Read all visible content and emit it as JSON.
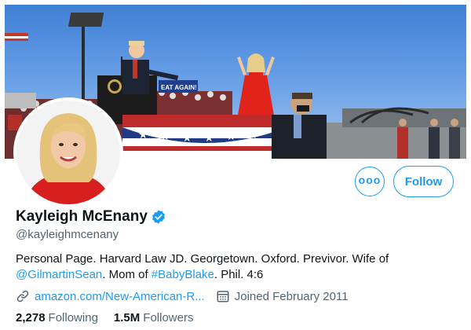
{
  "profile": {
    "name": "Kayleigh McEnany",
    "handle": "@kayleighmcenany",
    "bio": {
      "part1": "Personal Page. Harvard Law JD. Georgetown. Oxford. Previvor. Wife of ",
      "mention": "@GilmartinSean",
      "part2": ". Mom of ",
      "hashtag": "#BabyBlake",
      "part3": ". Phil. 4:6"
    },
    "website": "amazon.com/New-American-R...",
    "joined": "Joined February 2011"
  },
  "stats": {
    "following_count": "2,278",
    "following_label": "Following",
    "followers_count": "1.5M",
    "followers_label": "Followers"
  },
  "actions": {
    "more_label": "ooo",
    "follow_label": "Follow"
  },
  "banner": {
    "sign_text": "EAT AGAIN!"
  },
  "colors": {
    "accent": "#1d9bf0",
    "text": "#0f1419",
    "muted": "#536471"
  },
  "icons": {
    "verified": "verified-badge-icon",
    "link": "link-icon",
    "calendar": "calendar-icon",
    "more": "more-options-icon"
  }
}
